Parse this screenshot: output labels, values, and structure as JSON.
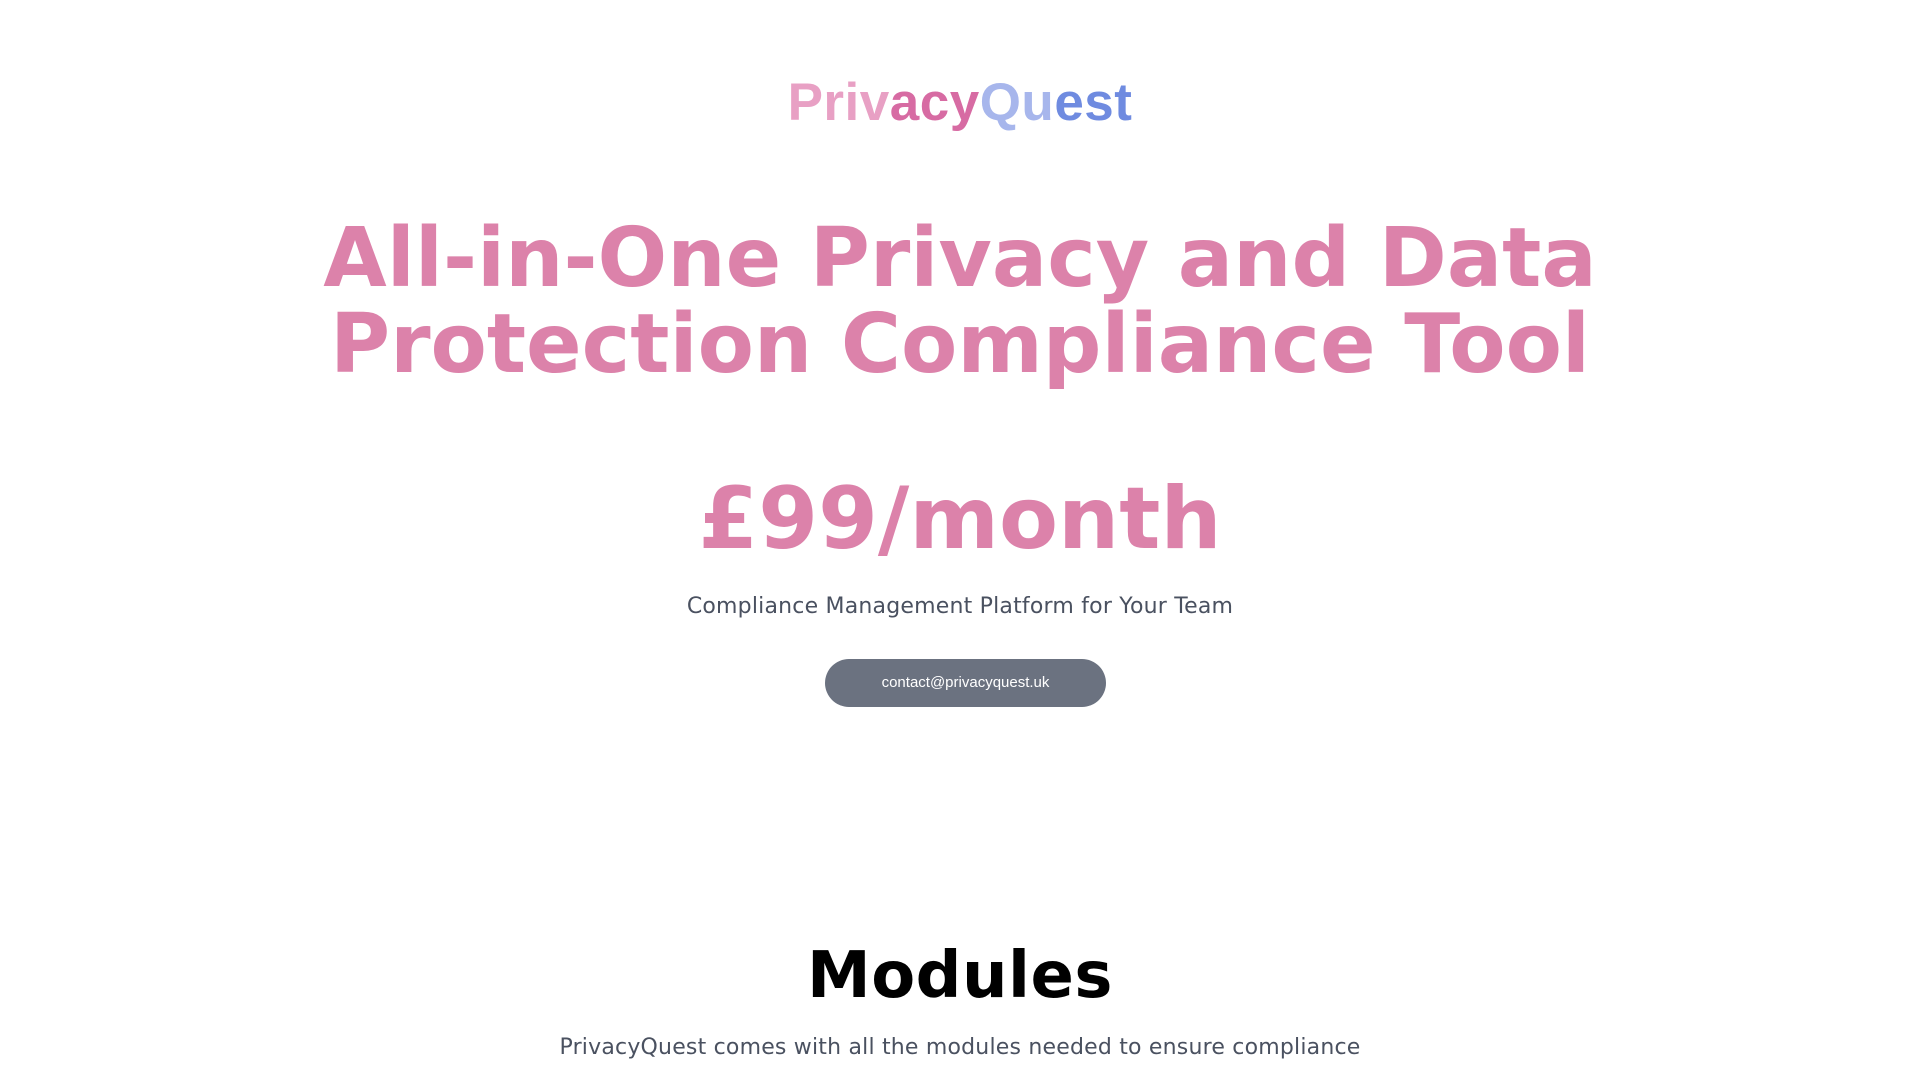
{
  "brand": {
    "logo_part1a": "Priv",
    "logo_part1b": "acy",
    "logo_part2a": "Qu",
    "logo_part2b": "est",
    "colors": {
      "pink_light": "#e8a0c4",
      "pink": "#d76ba3",
      "blue_light": "#a7b6ec",
      "blue": "#6f8be0"
    }
  },
  "hero": {
    "headline_line1": "All-in-One Privacy and Data",
    "headline_line2": "Protection Compliance Tool",
    "price": "£99/month",
    "tagline": "Compliance Management Platform for Your Team",
    "contact_label": "contact@privacyquest.uk",
    "accent_color": "#dc82aa",
    "button_color": "#6b7280"
  },
  "modules": {
    "title": "Modules",
    "subtitle": "PrivacyQuest comes with all the modules needed to ensure compliance"
  }
}
